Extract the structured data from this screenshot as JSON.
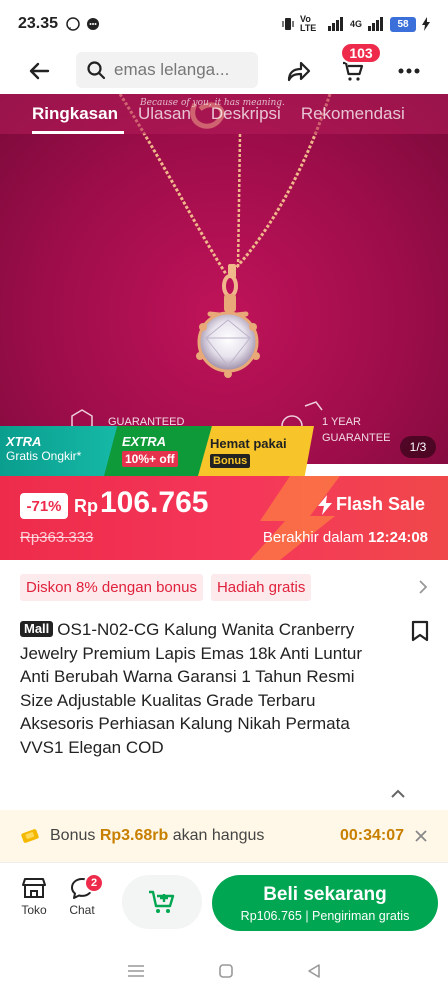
{
  "status_bar": {
    "time": "23.35",
    "network": "Vo LTE",
    "signal_label": "4G",
    "battery": "58"
  },
  "top_nav": {
    "search_placeholder": "emas lelanga...",
    "cart_count": "103"
  },
  "hero": {
    "tabs": [
      {
        "label": "Ringkasan",
        "active": true
      },
      {
        "label": "Ulasan",
        "active": false
      },
      {
        "label": "Deskripsi",
        "active": false
      },
      {
        "label": "Rekomendasi",
        "active": false
      }
    ],
    "brand_tagline": "Because of you, it has meaning.",
    "guarantee_left": "GUARANTEED",
    "guarantee_right_1": "1 YEAR",
    "guarantee_right_2": "GUARANTEE",
    "image_counter": "1/3"
  },
  "promo": {
    "xtra_title": "XTRA",
    "xtra_sub": "Gratis Ongkir*",
    "extra_title": "EXTRA",
    "extra_sub": "10%+ off",
    "hemat_title": "Hemat pakai",
    "hemat_sub": "Bonus"
  },
  "flash": {
    "discount": "-71%",
    "currency": "Rp",
    "price": "106.765",
    "original_price": "Rp363.333",
    "label": "Flash Sale",
    "ends_label": "Berakhir dalam",
    "countdown": "12:24:08"
  },
  "tags": [
    "Diskon 8% dengan bonus",
    "Hadiah gratis"
  ],
  "product": {
    "mall_badge": "Mall",
    "title": "OS1-N02-CG Kalung Wanita Cranberry Jewelry Premium Lapis Emas 18k Anti Luntur Anti Berubah Warna Garansi 1 Tahun Resmi Size Adjustable Kualitas Grade Terbaru Aksesoris Perhiasan Kalung Nikah Permata VVS1 Elegan COD"
  },
  "bonus_bar": {
    "prefix": "Bonus",
    "amount": "Rp3.68rb",
    "suffix": "akan hangus",
    "timer": "00:34:07"
  },
  "bottom_bar": {
    "shop_label": "Toko",
    "chat_label": "Chat",
    "chat_badge": "2",
    "buy_label": "Beli sekarang",
    "buy_price": "Rp106.765",
    "buy_shipping": "Pengiriman gratis"
  },
  "colors": {
    "accent": "#ee2b4a",
    "buy_green": "#00a651",
    "hero_bg": "#9e0d4a"
  }
}
